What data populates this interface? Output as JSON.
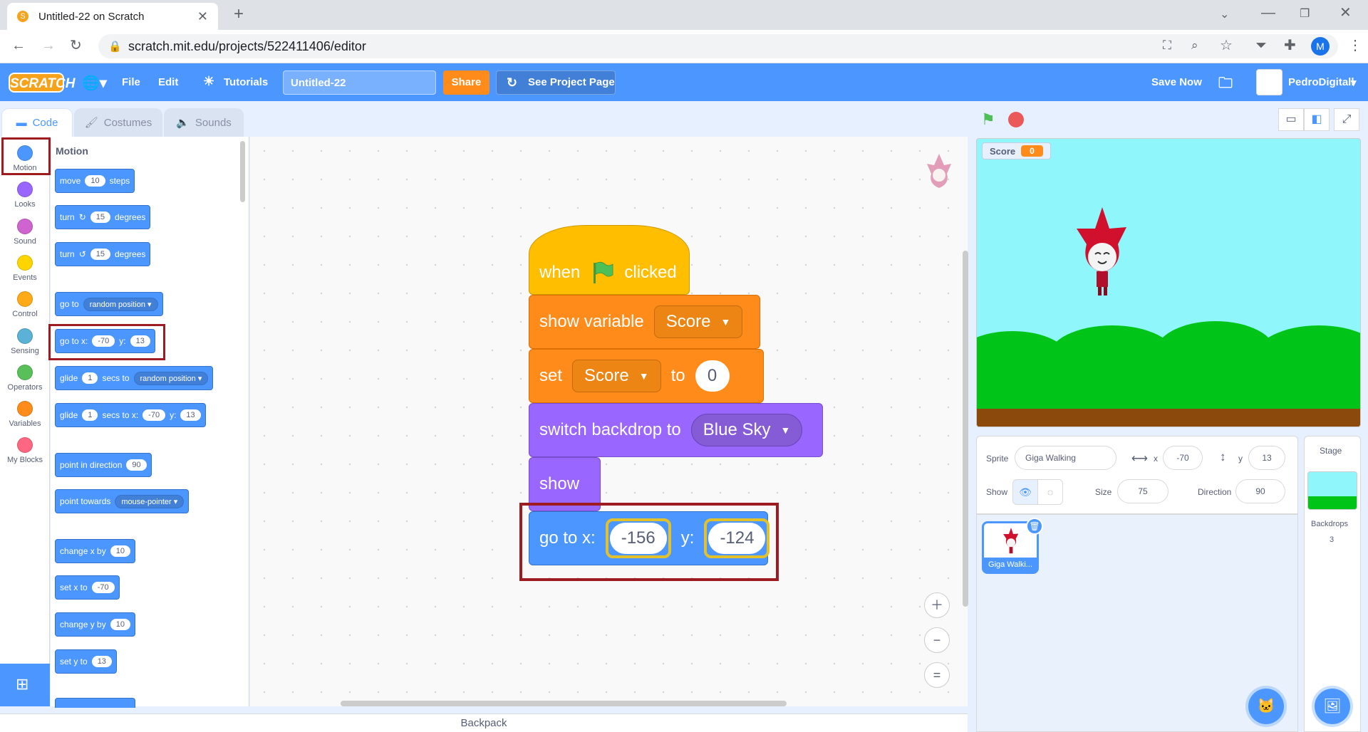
{
  "browser": {
    "tab_title": "Untitled-22 on Scratch",
    "url": "scratch.mit.edu/projects/522411406/editor",
    "profile_initial": "M"
  },
  "menubar": {
    "logo": "SCRATCH",
    "file": "File",
    "edit": "Edit",
    "tutorials": "Tutorials",
    "project_title": "Untitled-22",
    "share": "Share",
    "see_project_page": "See Project Page",
    "save_now": "Save Now",
    "username": "PedroDigitall"
  },
  "editor_tabs": {
    "code": "Code",
    "costumes": "Costumes",
    "sounds": "Sounds"
  },
  "categories": [
    {
      "label": "Motion",
      "color": "#4c97ff"
    },
    {
      "label": "Looks",
      "color": "#9966ff"
    },
    {
      "label": "Sound",
      "color": "#cf63cf"
    },
    {
      "label": "Events",
      "color": "#ffd500"
    },
    {
      "label": "Control",
      "color": "#ffab19"
    },
    {
      "label": "Sensing",
      "color": "#5cb1d6"
    },
    {
      "label": "Operators",
      "color": "#59c059"
    },
    {
      "label": "Variables",
      "color": "#ff8c1a"
    },
    {
      "label": "My Blocks",
      "color": "#ff6680"
    }
  ],
  "palette": {
    "heading": "Motion",
    "move": {
      "a": "move",
      "v": "10",
      "b": "steps"
    },
    "turn_right": {
      "a": "turn",
      "v": "15",
      "b": "degrees"
    },
    "turn_left": {
      "a": "turn",
      "v": "15",
      "b": "degrees"
    },
    "goto_random": {
      "a": "go to",
      "dd": "random position"
    },
    "goto_xy": {
      "a": "go to x:",
      "x": "-70",
      "b": "y:",
      "y": "13"
    },
    "glide_random": {
      "a": "glide",
      "v": "1",
      "b": "secs to",
      "dd": "random position"
    },
    "glide_xy": {
      "a": "glide",
      "v": "1",
      "b": "secs to x:",
      "x": "-70",
      "c": "y:",
      "y": "13"
    },
    "point_direction": {
      "a": "point in direction",
      "v": "90"
    },
    "point_towards": {
      "a": "point towards",
      "dd": "mouse-pointer"
    },
    "change_x": {
      "a": "change x by",
      "v": "10"
    },
    "set_x": {
      "a": "set x to",
      "v": "-70"
    },
    "change_y": {
      "a": "change y by",
      "v": "10"
    },
    "set_y": {
      "a": "set y to",
      "v": "13"
    }
  },
  "script": {
    "hat": {
      "a": "when",
      "b": "clicked"
    },
    "show_variable": {
      "a": "show variable",
      "dd": "Score"
    },
    "set_variable": {
      "a": "set",
      "dd": "Score",
      "b": "to",
      "v": "0"
    },
    "switch_backdrop": {
      "a": "switch backdrop to",
      "dd": "Blue Sky"
    },
    "show": "show",
    "goto_xy": {
      "a": "go to x:",
      "x": "-156",
      "b": "y:",
      "y": "-124"
    }
  },
  "stage": {
    "monitor_label": "Score",
    "monitor_value": "0"
  },
  "sprite_info": {
    "sprite_label": "Sprite",
    "sprite_name": "Giga Walking",
    "x_label": "x",
    "x": "-70",
    "y_label": "y",
    "y": "13",
    "show_label": "Show",
    "size_label": "Size",
    "size": "75",
    "direction_label": "Direction",
    "direction": "90"
  },
  "sprite_list": [
    {
      "name": "Giga Walki..."
    }
  ],
  "stage_pane": {
    "title": "Stage",
    "backdrops_label": "Backdrops",
    "backdrops_count": "3"
  },
  "backpack": "Backpack",
  "colors": {
    "motion": "#4c97ff",
    "looks": "#9966ff",
    "events": "#ffbf00",
    "variables": "#ff8c1a",
    "highlight": "#9e1b22"
  }
}
